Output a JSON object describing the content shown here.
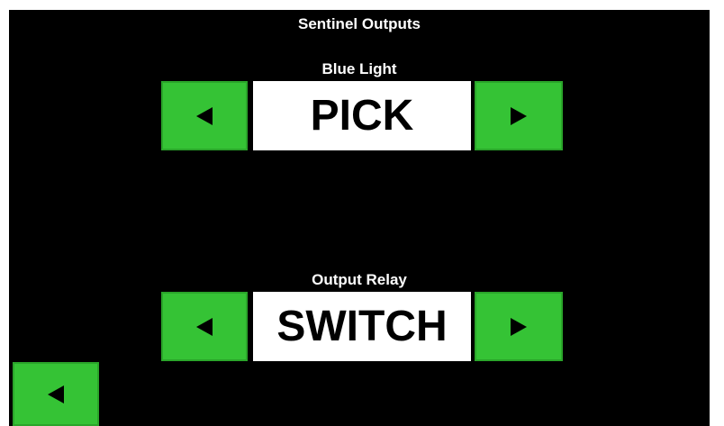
{
  "screen": {
    "title": "Sentinel Outputs"
  },
  "blue_light": {
    "label": "Blue Light",
    "value": "PICK",
    "prev_icon": "left-triangle-icon",
    "next_icon": "right-triangle-icon"
  },
  "output_relay": {
    "label": "Output Relay",
    "value": "SWITCH",
    "prev_icon": "left-triangle-icon",
    "next_icon": "right-triangle-icon"
  },
  "back_button": {
    "icon": "left-triangle-icon"
  },
  "colors": {
    "background": "#000000",
    "button_green": "#35c335",
    "value_box": "#ffffff",
    "text_light": "#ffffff"
  }
}
